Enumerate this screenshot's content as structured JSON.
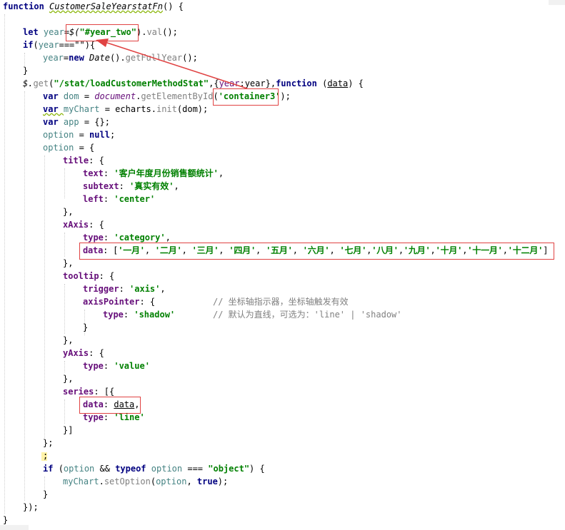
{
  "editor": {
    "lines": {
      "l1": {
        "a": "function ",
        "b": "CustomerSaleYearstatFn",
        "c": "() {"
      },
      "l3": {
        "a": "let ",
        "b": "year",
        "c": "=",
        "d": "$(",
        "e": "\"#year_two\"",
        "f": ").",
        "g": "val",
        "h": "();"
      },
      "l4": {
        "a": "if",
        "b": "(",
        "c": "year",
        "d": "===\"\"",
        "e": "){"
      },
      "l5": {
        "a": "year",
        "b": "=",
        "c": "new ",
        "d": "Date",
        "e": "().",
        "f": "getFullYear",
        "g": "();"
      },
      "l6": {
        "a": "}"
      },
      "l7": {
        "a": "$.",
        "b": "get",
        "c": "(",
        "d": "\"/stat/loadCustomerMethodStat\"",
        "e": ",{",
        "f": "year",
        "g": ":year},",
        "h": "function ",
        "i": "(",
        "j": "data",
        "k": ") {"
      },
      "l8": {
        "a": "var ",
        "b": "dom",
        "c": " = ",
        "d": "document",
        "e": ".",
        "f": "getElementById",
        "g": "(",
        "h": "'container3'",
        "i": ");"
      },
      "l9": {
        "a": "var ",
        "b": "myChart",
        "c": " = ",
        "d": "echarts",
        "e": ".",
        "f": "init",
        "g": "(dom);"
      },
      "l10": {
        "a": "var ",
        "b": "app",
        "c": " = {};"
      },
      "l11": {
        "a": "option",
        "b": " = ",
        "c": "null",
        "d": ";"
      },
      "l12": {
        "a": "option",
        "b": " = {"
      },
      "l13": {
        "a": "title",
        "b": ": {"
      },
      "l14": {
        "a": "text",
        "b": ": ",
        "c": "'客户年度月份销售额统计'",
        "d": ","
      },
      "l15": {
        "a": "subtext",
        "b": ": ",
        "c": "'真实有效'",
        "d": ","
      },
      "l16": {
        "a": "left",
        "b": ": ",
        "c": "'center'"
      },
      "l17": {
        "a": "},"
      },
      "l18": {
        "a": "xAxis",
        "b": ": {"
      },
      "l19": {
        "a": "type",
        "b": ": ",
        "c": "'category'",
        "d": ","
      },
      "l20": {
        "a": "data",
        "b": ": [",
        "c": "'一月'",
        "d": ", ",
        "e": "'二月'",
        "f": ", ",
        "g": "'三月'",
        "h": ", ",
        "i": "'四月'",
        "j": ", ",
        "k": "'五月'",
        "l": ", ",
        "m": "'六月'",
        "n": ", ",
        "o": "'七月'",
        "p": ",",
        "q": "'八月'",
        "r": ",",
        "s": "'九月'",
        "t": ",",
        "u": "'十月'",
        "v": ",",
        "w": "'十一月'",
        "x": ",",
        "y": "'十二月'",
        "z": "]"
      },
      "l21": {
        "a": "},"
      },
      "l22": {
        "a": "tooltip",
        "b": ": {"
      },
      "l23": {
        "a": "trigger",
        "b": ": ",
        "c": "'axis'",
        "d": ","
      },
      "l24": {
        "a": "axisPointer",
        "b": ": {",
        "c": "// 坐标轴指示器，坐标轴触发有效"
      },
      "l25": {
        "a": "type",
        "b": ": ",
        "c": "'shadow'",
        "d": "// 默认为直线，可选为：'line' | 'shadow'"
      },
      "l26": {
        "a": "}"
      },
      "l27": {
        "a": "},"
      },
      "l28": {
        "a": "yAxis",
        "b": ": {"
      },
      "l29": {
        "a": "type",
        "b": ": ",
        "c": "'value'"
      },
      "l30": {
        "a": "},"
      },
      "l31": {
        "a": "series",
        "b": ": [{"
      },
      "l32": {
        "a": "data",
        "b": ": ",
        "c": "data",
        "d": ","
      },
      "l33": {
        "a": "type",
        "b": ": ",
        "c": "'line'"
      },
      "l34": {
        "a": "}]"
      },
      "l35": {
        "a": "};"
      },
      "l36": {
        "a": ";"
      },
      "l37": {
        "a": "if ",
        "b": "(",
        "c": "option",
        "d": " && ",
        "e": "typeof ",
        "f": "option",
        "g": " === ",
        "h": "\"object\"",
        "i": ") {"
      },
      "l38": {
        "a": "myChart",
        "b": ".",
        "c": "setOption",
        "d": "(",
        "e": "option",
        "f": ", ",
        "g": "true",
        "h": ");"
      },
      "l39": {
        "a": "}"
      },
      "l40": {
        "a": "});"
      },
      "l41": {
        "a": "}"
      }
    }
  },
  "colors": {
    "keyword": "#000080",
    "string": "#008000",
    "property": "#660e7a",
    "variable": "#458383",
    "comment": "#808080",
    "annotation": "#e04343"
  }
}
